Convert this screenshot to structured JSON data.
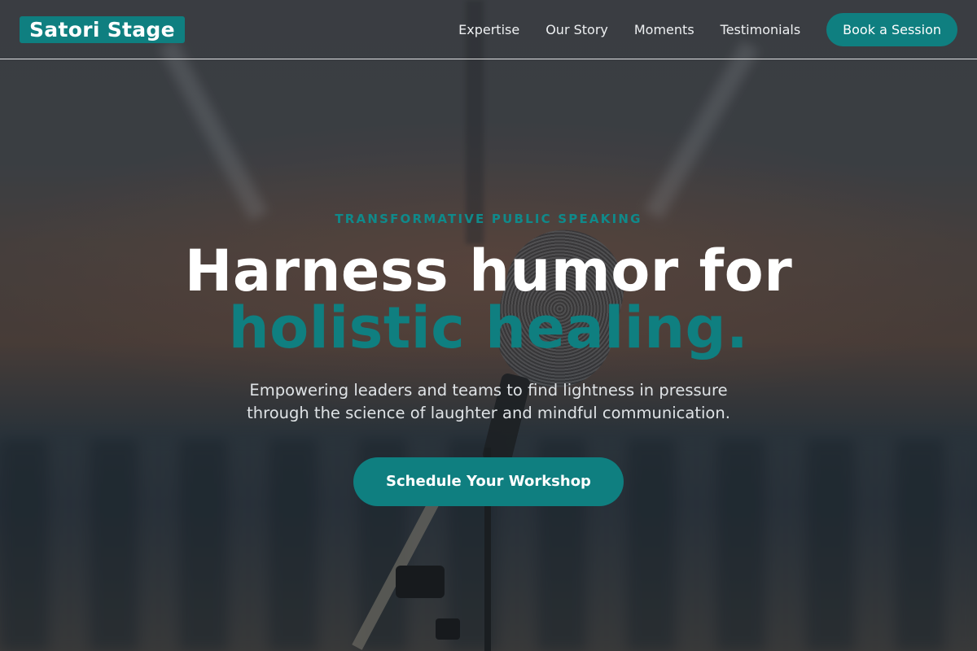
{
  "brand": {
    "logo_text": "Satori Stage",
    "accent_color": "#0f7f80"
  },
  "nav": {
    "links": [
      "Expertise",
      "Our Story",
      "Moments",
      "Testimonials"
    ],
    "cta_label": "Book a Session"
  },
  "hero": {
    "eyebrow": "TRANSFORMATIVE PUBLIC SPEAKING",
    "headline_line1": "Harness humor for",
    "headline_line2": "holistic healing.",
    "subtitle_line1": "Empowering leaders and teams to find lightness in pressure",
    "subtitle_line2": "through the science of laughter and mindful communication.",
    "cta_label": "Schedule Your Workshop"
  }
}
